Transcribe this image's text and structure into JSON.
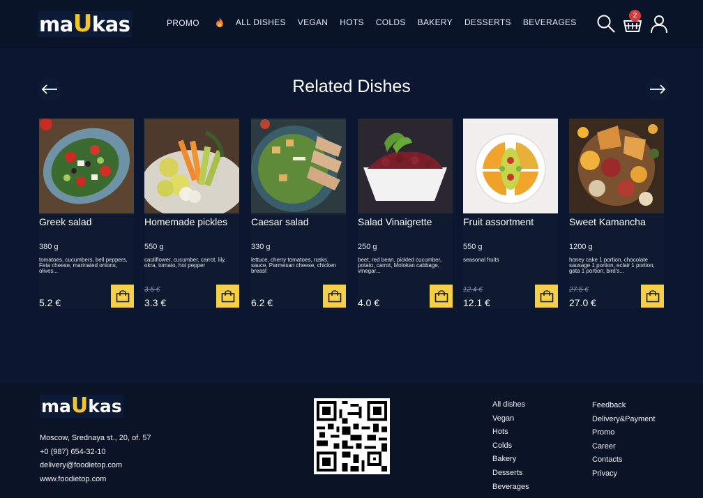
{
  "header": {
    "logo_left": "ma",
    "logo_u": "U",
    "logo_right": "kas",
    "nav": [
      "PROMO",
      "ALL DISHES",
      "VEGAN",
      "HOTS",
      "COLDS",
      "BAKERY",
      "DESSERTS",
      "BEVERAGES"
    ],
    "cart_count": "2",
    "icons": [
      "search-icon",
      "basket-icon",
      "user-icon"
    ]
  },
  "section": {
    "title": "Related Dishes"
  },
  "cards": [
    {
      "name": "Greek salad",
      "weight": "380 g",
      "ingredients": "tomatoes, cucumbers, bell peppers, Feta cheese, marinated onions, olives...",
      "old_price": "",
      "price": "5.2 €"
    },
    {
      "name": "Homemade pickles",
      "weight": "550 g",
      "ingredients": "cauliflower, cucumber, carrot, lily, okra, tomato, hot pepper",
      "old_price": "3.5 €",
      "price": "3.3 €"
    },
    {
      "name": "Caesar salad",
      "weight": "330 g",
      "ingredients": "lettuce, cherry tomatoes, rusks, sauce, Parmesan cheese, chicken breast",
      "old_price": "",
      "price": "6.2 €"
    },
    {
      "name": "Salad Vinaigrette",
      "weight": "250 g",
      "ingredients": "beet, red bean, pickled cucumber, potato, carrot, Molokan cabbage, vinegar...",
      "old_price": "",
      "price": "4.0 €"
    },
    {
      "name": "Fruit assortment",
      "weight": "550 g",
      "ingredients": "seasonal fruits",
      "old_price": "12.4 €",
      "price": "12.1 €"
    },
    {
      "name": "Sweet Kamancha",
      "weight": "1200 g",
      "ingredients": "honey cake 1 portion, chocolate sausage 1 portion, eclair 1 portion, gata 1 portion, bird's...",
      "old_price": "27.5 €",
      "price": "27.0 €"
    }
  ],
  "footer": {
    "contacts": [
      "Moscow, Srednaya st., 20, of. 57",
      "+0 (987) 654-32-10",
      "delivery@foodietop.com",
      "www.foodietop.com"
    ],
    "col1": [
      "All dishes",
      "Vegan",
      "Hots",
      "Colds",
      "Bakery",
      "Desserts",
      "Beverages"
    ],
    "col2": [
      "Feedback",
      "Delivery&Payment",
      "Promo",
      "Career",
      "Contacts",
      "Privacy"
    ]
  },
  "colors": {
    "background": "#0b1730",
    "accent": "#f5cf45",
    "badge": "#d93a3a"
  }
}
